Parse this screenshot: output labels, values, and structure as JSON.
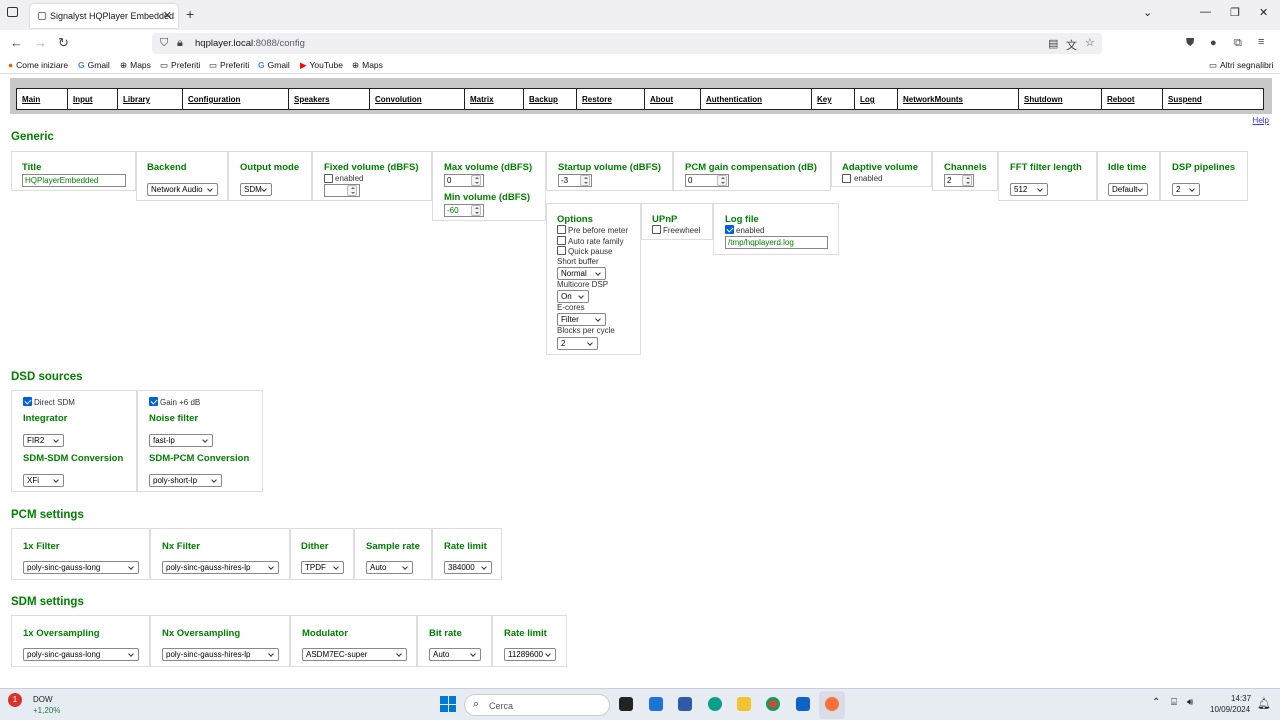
{
  "browser": {
    "tab_title": "Signalyst HQPlayer Embedded",
    "url_host": "hqplayer.local",
    "url_rest": ":8088/config",
    "bookmarks": [
      "Come iniziare",
      "Gmail",
      "Maps",
      "Preferiti",
      "Preferiti",
      "Gmail",
      "YouTube",
      "Maps"
    ],
    "other_bookmarks": "Altri segnalibri"
  },
  "menu": [
    "Main",
    "Input",
    "Library",
    "Configuration",
    "Speakers",
    "Convolution",
    "Matrix",
    "Backup",
    "Restore",
    "About",
    "Authentication",
    "Key",
    "Log",
    "NetworkMounts",
    "Shutdown",
    "Reboot",
    "Suspend"
  ],
  "help": "Help",
  "generic": {
    "heading": "Generic",
    "title_label": "Title",
    "title_value": "HQPlayerEmbedded",
    "backend_label": "Backend",
    "backend_value": "Network Audio",
    "output_mode_label": "Output mode",
    "output_mode_value": "SDM",
    "fixed_volume_label": "Fixed volume (dBFS)",
    "enabled": "enabled",
    "max_volume_label": "Max volume (dBFS)",
    "max_volume_value": "0",
    "min_volume_label": "Min volume (dBFS)",
    "min_volume_value": "-60",
    "startup_volume_label": "Startup volume (dBFS)",
    "startup_volume_value": "-3",
    "pcm_gain_label": "PCM gain compensation (dB)",
    "pcm_gain_value": "0",
    "adaptive_volume_label": "Adaptive volume",
    "channels_label": "Channels",
    "channels_value": "2",
    "fft_label": "FFT filter length",
    "fft_value": "512",
    "idle_label": "Idle time",
    "idle_value": "Default",
    "dsp_label": "DSP pipelines",
    "dsp_value": "2",
    "options_label": "Options",
    "pre_before_meter": "Pre before meter",
    "auto_rate_family": "Auto rate family",
    "quick_pause": "Quick pause",
    "short_buffer_label": "Short buffer",
    "short_buffer_value": "Normal",
    "multicore_label": "Multicore DSP",
    "multicore_value": "On",
    "ecores_label": "E-cores",
    "ecores_value": "Filter",
    "blocks_label": "Blocks per cycle",
    "blocks_value": "2",
    "upnp_label": "UPnP",
    "freewheel": "Freewheel",
    "logfile_label": "Log file",
    "logfile_value": "/tmp/hqplayerd.log"
  },
  "dsd": {
    "heading": "DSD sources",
    "direct_sdm": "Direct SDM",
    "gain": "Gain +6 dB",
    "integrator_label": "Integrator",
    "integrator_value": "FIR2",
    "noise_filter_label": "Noise filter",
    "noise_filter_value": "fast-lp",
    "sdm_sdm_label": "SDM-SDM Conversion",
    "sdm_sdm_value": "XFi",
    "sdm_pcm_label": "SDM-PCM Conversion",
    "sdm_pcm_value": "poly-short-lp"
  },
  "pcm": {
    "heading": "PCM settings",
    "f1x_label": "1x Filter",
    "f1x_value": "poly-sinc-gauss-long",
    "nx_label": "Nx Filter",
    "nx_value": "poly-sinc-gauss-hires-lp",
    "dither_label": "Dither",
    "dither_value": "TPDF",
    "rate_label": "Sample rate",
    "rate_value": "Auto",
    "limit_label": "Rate limit",
    "limit_value": "384000"
  },
  "sdm": {
    "heading": "SDM settings",
    "o1x_label": "1x Oversampling",
    "o1x_value": "poly-sinc-gauss-long",
    "onx_label": "Nx Oversampling",
    "onx_value": "poly-sinc-gauss-hires-lp",
    "mod_label": "Modulator",
    "mod_value": "ASDM7EC-super",
    "bitrate_label": "Bit rate",
    "bitrate_value": "Auto",
    "limit_label": "Rate limit",
    "limit_value": "11289600"
  },
  "taskbar": {
    "stock_name": "DOW",
    "stock_change": "+1,20%",
    "search_placeholder": "Cerca",
    "time": "14:37",
    "date": "10/09/2024",
    "badge": "1"
  }
}
